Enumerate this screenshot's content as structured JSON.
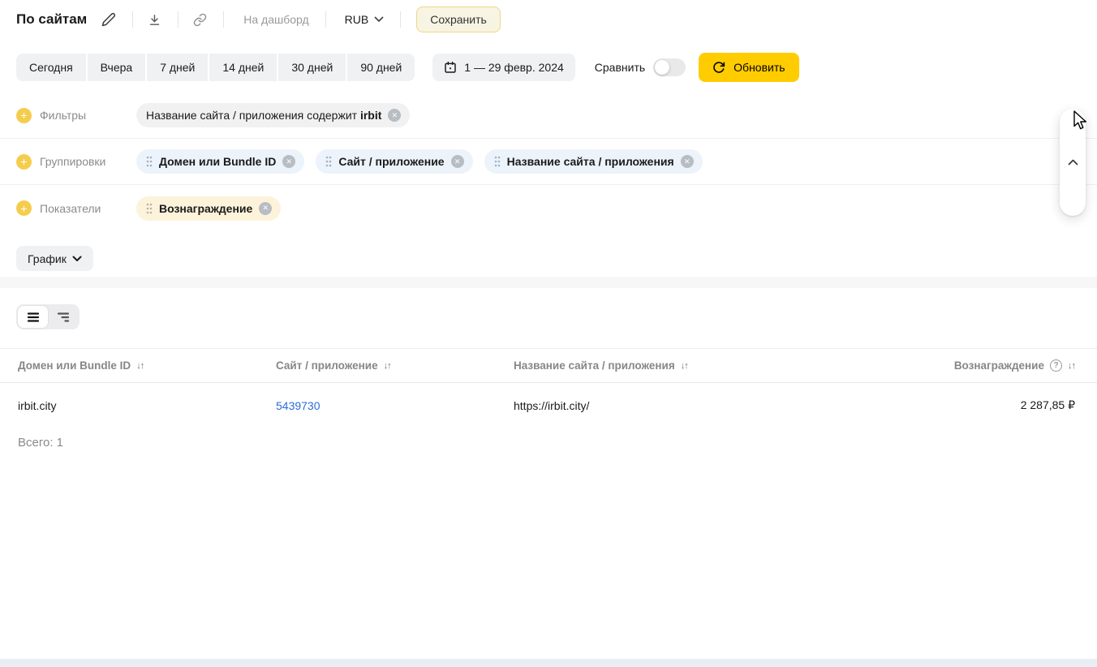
{
  "header": {
    "title": "По сайтам",
    "dashboard_link": "На дашборд",
    "currency": "RUB",
    "save_label": "Сохранить"
  },
  "toolbar": {
    "presets": [
      "Сегодня",
      "Вчера",
      "7 дней",
      "14 дней",
      "30 дней",
      "90 дней"
    ],
    "date_range": "1 — 29 февр. 2024",
    "compare_label": "Сравнить",
    "compare_toggle_state": "off",
    "refresh_label": "Обновить"
  },
  "filters": {
    "label": "Фильтры",
    "chip_prefix": "Название сайта / приложения содержит",
    "chip_value": "irbit"
  },
  "groupings": {
    "label": "Группировки",
    "chips": [
      "Домен или Bundle ID",
      "Сайт / приложение",
      "Название сайта / приложения"
    ]
  },
  "metrics": {
    "label": "Показатели",
    "chips": [
      "Вознаграждение"
    ]
  },
  "chart_toggle": {
    "label": "График"
  },
  "table": {
    "columns": [
      "Домен или Bundle ID",
      "Сайт / приложение",
      "Название сайта / приложения",
      "Вознаграждение"
    ],
    "rows": [
      [
        "irbit.city",
        "5439730",
        "https://irbit.city/",
        "2 287,85 ₽"
      ]
    ],
    "total_label": "Всего: 1"
  },
  "icons": {
    "plus": "+",
    "remove": "✕",
    "sort": "↓↑",
    "question": "?"
  },
  "colors": {
    "accent_yellow": "#ffcc00",
    "save_border_yellow": "#eed784",
    "link_blue": "#2b6cd9",
    "chip_gray": "#f1f1f1",
    "chip_blue": "#edf3fa",
    "chip_yellow": "#fcf3da",
    "muted_text": "#8b8b8b",
    "bottom_strip": "#e9eef4"
  }
}
